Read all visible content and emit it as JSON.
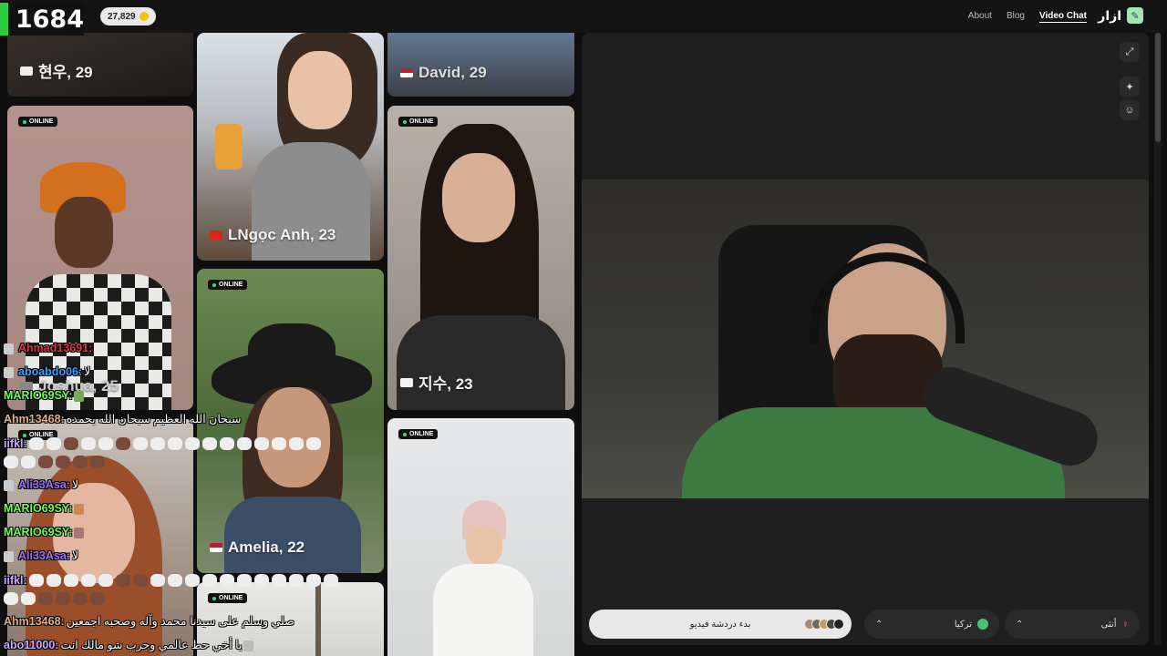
{
  "overlay": {
    "viewer_count": "1684"
  },
  "header": {
    "coins": "27,829",
    "nav": [
      "About",
      "Blog",
      "Video Chat"
    ],
    "brand": "ازار"
  },
  "cards": [
    {
      "name": "현우, 29",
      "online": false
    },
    {
      "name": "David, 29",
      "online": false
    },
    {
      "name": "Joshua, 25",
      "online": true,
      "online_label": "ONLINE"
    },
    {
      "name": "LNgọc Anh, 23",
      "online": false
    },
    {
      "name": "지수, 23",
      "online": true,
      "online_label": "ONLINE"
    },
    {
      "name": "Amelia, 22",
      "online": true,
      "online_label": "ONLINE"
    },
    {
      "name": "",
      "online": true,
      "online_label": "ONLINE"
    },
    {
      "name": "",
      "online": true,
      "online_label": "ONLINE"
    },
    {
      "name": "",
      "online": true,
      "online_label": "ONLINE"
    }
  ],
  "controls": {
    "start_label": "بدء دردشة فيديو",
    "country_label": "تركيا",
    "gender_label": "أنثى"
  },
  "chat": [
    {
      "user": "Ahmad13691:",
      "color": "#e0334b",
      "msg": ""
    },
    {
      "user": "aboabdo06:",
      "color": "#3aa0ff",
      "msg": "لا"
    },
    {
      "user": "MARIO69SY:",
      "color": "#6dff4a",
      "msg": ""
    },
    {
      "user": "Ahm13468:",
      "color": "#e0b08a",
      "msg": "سبحان الله العظيم سبحان الله بحمده"
    },
    {
      "user": "iifkl:",
      "color": "#c9a7ff",
      "msg": ""
    },
    {
      "user": "Ali33Asa:",
      "color": "#a46bff",
      "msg": "لا"
    },
    {
      "user": "MARIO69SY:",
      "color": "#6dff4a",
      "msg": ""
    },
    {
      "user": "MARIO69SY:",
      "color": "#6dff4a",
      "msg": ""
    },
    {
      "user": "Ali33Asa:",
      "color": "#a46bff",
      "msg": "لا"
    },
    {
      "user": "iifkl:",
      "color": "#c9a7ff",
      "msg": ""
    },
    {
      "user": "Ahm13468:",
      "color": "#e0b08a",
      "msg": "صلي وسلم على سيدنا محمد وآله وصحبه اجمعين"
    },
    {
      "user": "abo11000:",
      "color": "#c9a7ff",
      "msg": "يا أخي حط عالمي وجرب شو مالك انت"
    }
  ],
  "colors": {
    "online_dot": "#3ddc84",
    "accent": "#a4e6b0"
  }
}
